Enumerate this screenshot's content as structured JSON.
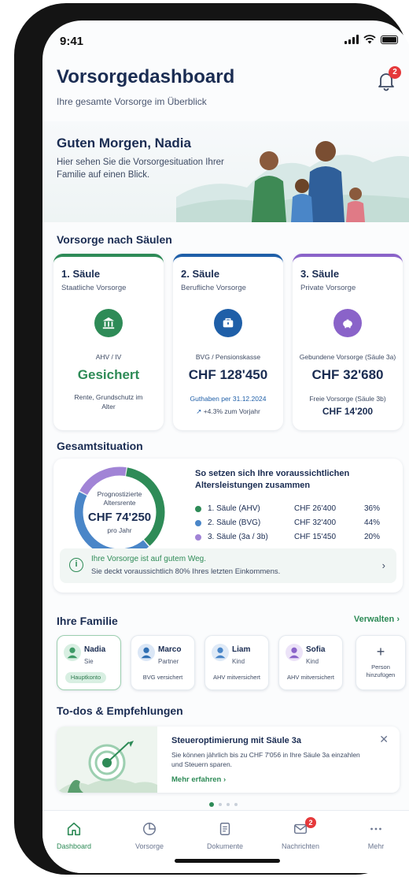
{
  "status": {
    "time": "9:41"
  },
  "header": {
    "title": "Vorsorgedashboard",
    "subtitle": "Ihre gesamte Vorsorge im Überblick",
    "notification_count": "2"
  },
  "hero": {
    "greeting": "Guten Morgen, Nadia",
    "text": "Hier sehen Sie die Vorsorgesituation Ihrer Familie auf einen Blick."
  },
  "pillars": {
    "section_title": "Vorsorge nach Säulen",
    "items": [
      {
        "title": "1. Säule",
        "subtitle": "Staatliche Vorsorge",
        "icon": "bank-icon",
        "color": "#2e8b57",
        "label": "AHV / IV",
        "value": "Gesichert",
        "note": "Rente, Grundschutz im Alter"
      },
      {
        "title": "2. Säule",
        "subtitle": "Berufliche Vorsorge",
        "icon": "briefcase-icon",
        "color": "#1f5fa8",
        "label": "BVG / Pensionskasse",
        "value": "CHF 128'450",
        "note": "Guthaben per 31.12.2024",
        "trend": "+4.3% zum Vorjahr"
      },
      {
        "title": "3. Säule",
        "subtitle": "Private Vorsorge",
        "icon": "piggy-bank-icon",
        "color": "#8a63c9",
        "label": "Gebundene Vorsorge (Säule 3a)",
        "value": "CHF 32'680",
        "sub_label": "Freie Vorsorge (Säule 3b)",
        "sub_value": "CHF 14'200"
      }
    ]
  },
  "overview": {
    "section_title": "Gesamtsituation",
    "donut_label": "Prognostizierte Altersrente",
    "donut_value": "CHF 74'250",
    "donut_unit": "pro Jahr",
    "heading": "So setzen sich Ihre voraussichtlichen Altersleistungen zusammen",
    "rows": [
      {
        "name": "1. Säule (AHV)",
        "value": "CHF 26'400",
        "pct": "36%",
        "share": 36,
        "color": "#2e8b57"
      },
      {
        "name": "2. Säule (BVG)",
        "value": "CHF 32'400",
        "pct": "44%",
        "share": 44,
        "color": "#4a86c8"
      },
      {
        "name": "3. Säule (3a / 3b)",
        "value": "CHF 15'450",
        "pct": "20%",
        "share": 20,
        "color": "#a184d6"
      }
    ],
    "info_title": "Ihre Vorsorge ist auf gutem Weg.",
    "info_text": "Sie deckt voraussichtlich 80% Ihres letzten Einkommens."
  },
  "family": {
    "section_title": "Ihre Familie",
    "manage_label": "Verwalten",
    "members": [
      {
        "name": "Nadia",
        "role": "Sie",
        "status": "Hauptkonto",
        "color": "#3e9a66",
        "bg": "#d8efe2"
      },
      {
        "name": "Marco",
        "role": "Partner",
        "status": "BVG versichert",
        "color": "#2f6fb3",
        "bg": "#dbe7f6"
      },
      {
        "name": "Liam",
        "role": "Kind",
        "status": "AHV mitversichert",
        "color": "#4a86c8",
        "bg": "#dfeaf7"
      },
      {
        "name": "Sofia",
        "role": "Kind",
        "status": "AHV mitversichert",
        "color": "#8a63c9",
        "bg": "#ece3f8"
      }
    ],
    "add_label": "Person hinzufügen"
  },
  "todos": {
    "section_title": "To-dos & Empfehlungen",
    "card_title": "Steueroptimierung mit Säule 3a",
    "card_text": "Sie können jährlich bis zu CHF 7'056 in Ihre Säule 3a einzahlen und Steuern sparen.",
    "card_link": "Mehr erfahren"
  },
  "tabbar": {
    "items": [
      {
        "label": "Dashboard",
        "icon": "home-icon"
      },
      {
        "label": "Vorsorge",
        "icon": "pie-chart-icon"
      },
      {
        "label": "Dokumente",
        "icon": "document-icon"
      },
      {
        "label": "Nachrichten",
        "icon": "mail-icon",
        "badge": "2"
      },
      {
        "label": "Mehr",
        "icon": "more-icon"
      }
    ]
  }
}
